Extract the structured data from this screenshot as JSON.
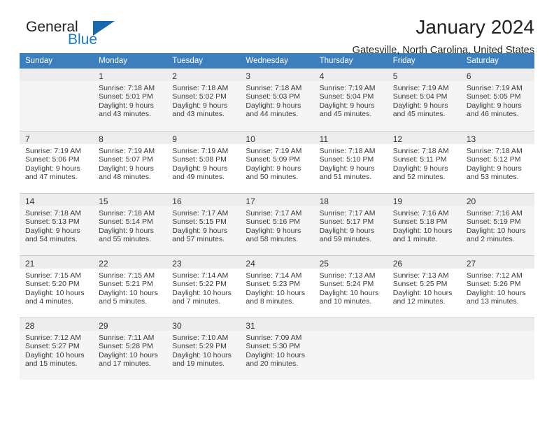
{
  "brand": {
    "name_part1": "General",
    "name_part2": "Blue",
    "triangle_icon": "triangle-icon"
  },
  "header": {
    "month_title": "January 2024",
    "location": "Gatesville, North Carolina, United States"
  },
  "colors": {
    "header_row": "#3d7ebd",
    "brand_blue": "#1b7fc4",
    "triangle": "#1868ad",
    "daynum_bg": "#ededed",
    "shaded_row": "#f5f5f5",
    "grid_line": "#c9c9c9"
  },
  "calendar": {
    "weekday_headers": [
      "Sunday",
      "Monday",
      "Tuesday",
      "Wednesday",
      "Thursday",
      "Friday",
      "Saturday"
    ],
    "weeks": [
      [
        {
          "day": "",
          "sunrise": "",
          "sunset": "",
          "daylight1": "",
          "daylight2": ""
        },
        {
          "day": "1",
          "sunrise": "Sunrise: 7:18 AM",
          "sunset": "Sunset: 5:01 PM",
          "daylight1": "Daylight: 9 hours",
          "daylight2": "and 43 minutes."
        },
        {
          "day": "2",
          "sunrise": "Sunrise: 7:18 AM",
          "sunset": "Sunset: 5:02 PM",
          "daylight1": "Daylight: 9 hours",
          "daylight2": "and 43 minutes."
        },
        {
          "day": "3",
          "sunrise": "Sunrise: 7:18 AM",
          "sunset": "Sunset: 5:03 PM",
          "daylight1": "Daylight: 9 hours",
          "daylight2": "and 44 minutes."
        },
        {
          "day": "4",
          "sunrise": "Sunrise: 7:19 AM",
          "sunset": "Sunset: 5:04 PM",
          "daylight1": "Daylight: 9 hours",
          "daylight2": "and 45 minutes."
        },
        {
          "day": "5",
          "sunrise": "Sunrise: 7:19 AM",
          "sunset": "Sunset: 5:04 PM",
          "daylight1": "Daylight: 9 hours",
          "daylight2": "and 45 minutes."
        },
        {
          "day": "6",
          "sunrise": "Sunrise: 7:19 AM",
          "sunset": "Sunset: 5:05 PM",
          "daylight1": "Daylight: 9 hours",
          "daylight2": "and 46 minutes."
        }
      ],
      [
        {
          "day": "7",
          "sunrise": "Sunrise: 7:19 AM",
          "sunset": "Sunset: 5:06 PM",
          "daylight1": "Daylight: 9 hours",
          "daylight2": "and 47 minutes."
        },
        {
          "day": "8",
          "sunrise": "Sunrise: 7:19 AM",
          "sunset": "Sunset: 5:07 PM",
          "daylight1": "Daylight: 9 hours",
          "daylight2": "and 48 minutes."
        },
        {
          "day": "9",
          "sunrise": "Sunrise: 7:19 AM",
          "sunset": "Sunset: 5:08 PM",
          "daylight1": "Daylight: 9 hours",
          "daylight2": "and 49 minutes."
        },
        {
          "day": "10",
          "sunrise": "Sunrise: 7:19 AM",
          "sunset": "Sunset: 5:09 PM",
          "daylight1": "Daylight: 9 hours",
          "daylight2": "and 50 minutes."
        },
        {
          "day": "11",
          "sunrise": "Sunrise: 7:18 AM",
          "sunset": "Sunset: 5:10 PM",
          "daylight1": "Daylight: 9 hours",
          "daylight2": "and 51 minutes."
        },
        {
          "day": "12",
          "sunrise": "Sunrise: 7:18 AM",
          "sunset": "Sunset: 5:11 PM",
          "daylight1": "Daylight: 9 hours",
          "daylight2": "and 52 minutes."
        },
        {
          "day": "13",
          "sunrise": "Sunrise: 7:18 AM",
          "sunset": "Sunset: 5:12 PM",
          "daylight1": "Daylight: 9 hours",
          "daylight2": "and 53 minutes."
        }
      ],
      [
        {
          "day": "14",
          "sunrise": "Sunrise: 7:18 AM",
          "sunset": "Sunset: 5:13 PM",
          "daylight1": "Daylight: 9 hours",
          "daylight2": "and 54 minutes."
        },
        {
          "day": "15",
          "sunrise": "Sunrise: 7:18 AM",
          "sunset": "Sunset: 5:14 PM",
          "daylight1": "Daylight: 9 hours",
          "daylight2": "and 55 minutes."
        },
        {
          "day": "16",
          "sunrise": "Sunrise: 7:17 AM",
          "sunset": "Sunset: 5:15 PM",
          "daylight1": "Daylight: 9 hours",
          "daylight2": "and 57 minutes."
        },
        {
          "day": "17",
          "sunrise": "Sunrise: 7:17 AM",
          "sunset": "Sunset: 5:16 PM",
          "daylight1": "Daylight: 9 hours",
          "daylight2": "and 58 minutes."
        },
        {
          "day": "18",
          "sunrise": "Sunrise: 7:17 AM",
          "sunset": "Sunset: 5:17 PM",
          "daylight1": "Daylight: 9 hours",
          "daylight2": "and 59 minutes."
        },
        {
          "day": "19",
          "sunrise": "Sunrise: 7:16 AM",
          "sunset": "Sunset: 5:18 PM",
          "daylight1": "Daylight: 10 hours",
          "daylight2": "and 1 minute."
        },
        {
          "day": "20",
          "sunrise": "Sunrise: 7:16 AM",
          "sunset": "Sunset: 5:19 PM",
          "daylight1": "Daylight: 10 hours",
          "daylight2": "and 2 minutes."
        }
      ],
      [
        {
          "day": "21",
          "sunrise": "Sunrise: 7:15 AM",
          "sunset": "Sunset: 5:20 PM",
          "daylight1": "Daylight: 10 hours",
          "daylight2": "and 4 minutes."
        },
        {
          "day": "22",
          "sunrise": "Sunrise: 7:15 AM",
          "sunset": "Sunset: 5:21 PM",
          "daylight1": "Daylight: 10 hours",
          "daylight2": "and 5 minutes."
        },
        {
          "day": "23",
          "sunrise": "Sunrise: 7:14 AM",
          "sunset": "Sunset: 5:22 PM",
          "daylight1": "Daylight: 10 hours",
          "daylight2": "and 7 minutes."
        },
        {
          "day": "24",
          "sunrise": "Sunrise: 7:14 AM",
          "sunset": "Sunset: 5:23 PM",
          "daylight1": "Daylight: 10 hours",
          "daylight2": "and 8 minutes."
        },
        {
          "day": "25",
          "sunrise": "Sunrise: 7:13 AM",
          "sunset": "Sunset: 5:24 PM",
          "daylight1": "Daylight: 10 hours",
          "daylight2": "and 10 minutes."
        },
        {
          "day": "26",
          "sunrise": "Sunrise: 7:13 AM",
          "sunset": "Sunset: 5:25 PM",
          "daylight1": "Daylight: 10 hours",
          "daylight2": "and 12 minutes."
        },
        {
          "day": "27",
          "sunrise": "Sunrise: 7:12 AM",
          "sunset": "Sunset: 5:26 PM",
          "daylight1": "Daylight: 10 hours",
          "daylight2": "and 13 minutes."
        }
      ],
      [
        {
          "day": "28",
          "sunrise": "Sunrise: 7:12 AM",
          "sunset": "Sunset: 5:27 PM",
          "daylight1": "Daylight: 10 hours",
          "daylight2": "and 15 minutes."
        },
        {
          "day": "29",
          "sunrise": "Sunrise: 7:11 AM",
          "sunset": "Sunset: 5:28 PM",
          "daylight1": "Daylight: 10 hours",
          "daylight2": "and 17 minutes."
        },
        {
          "day": "30",
          "sunrise": "Sunrise: 7:10 AM",
          "sunset": "Sunset: 5:29 PM",
          "daylight1": "Daylight: 10 hours",
          "daylight2": "and 19 minutes."
        },
        {
          "day": "31",
          "sunrise": "Sunrise: 7:09 AM",
          "sunset": "Sunset: 5:30 PM",
          "daylight1": "Daylight: 10 hours",
          "daylight2": "and 20 minutes."
        },
        {
          "day": "",
          "sunrise": "",
          "sunset": "",
          "daylight1": "",
          "daylight2": ""
        },
        {
          "day": "",
          "sunrise": "",
          "sunset": "",
          "daylight1": "",
          "daylight2": ""
        },
        {
          "day": "",
          "sunrise": "",
          "sunset": "",
          "daylight1": "",
          "daylight2": ""
        }
      ]
    ]
  }
}
